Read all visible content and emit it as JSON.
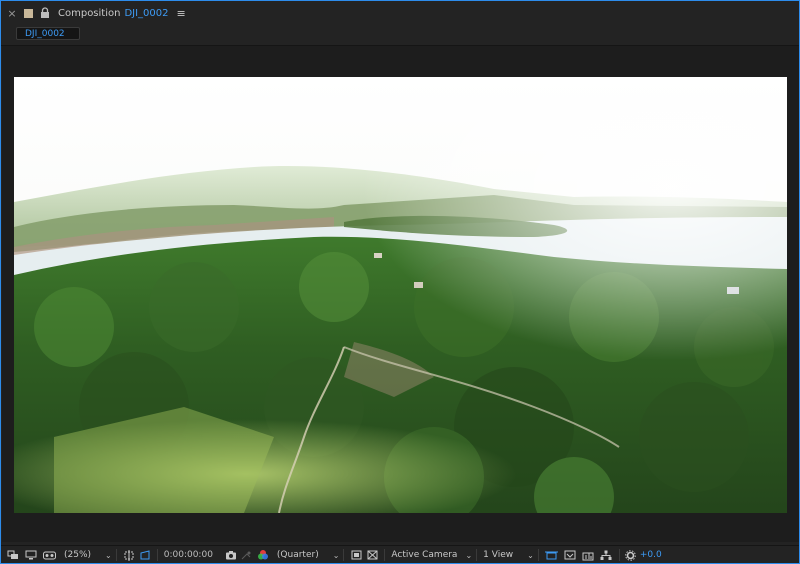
{
  "panel": {
    "close_glyph": "×",
    "title": "Composition",
    "comp_name": "DJI_0002",
    "menu_glyph": "≡"
  },
  "tabs": [
    {
      "label": "DJI_0002"
    }
  ],
  "viewer": {
    "content": "aerial-footage-river-forest"
  },
  "toolbar": {
    "magnification": "(25%)",
    "timecode": "0:00:00:00",
    "resolution": "(Quarter)",
    "camera": "Active Camera",
    "views": "1 View",
    "exposure": "+0.0",
    "caret": "⌄"
  },
  "colors": {
    "accent": "#3d9bf5",
    "panel_bg": "#232323",
    "viewer_bg": "#1d1d1d"
  },
  "icons": [
    "close-icon",
    "label-color-icon",
    "lock-icon",
    "panel-menu-icon",
    "always-preview-icon",
    "monitor-icon",
    "vr-goggles-icon",
    "region-of-interest-icon",
    "transparency-grid-icon",
    "snapshot-camera-icon",
    "show-snapshot-icon",
    "rgb-channels-icon",
    "fast-preview-icon",
    "grid-guides-icon",
    "timeline-icon",
    "comp-flowchart-icon",
    "3d-renderer-icon",
    "reset-exposure-icon"
  ]
}
